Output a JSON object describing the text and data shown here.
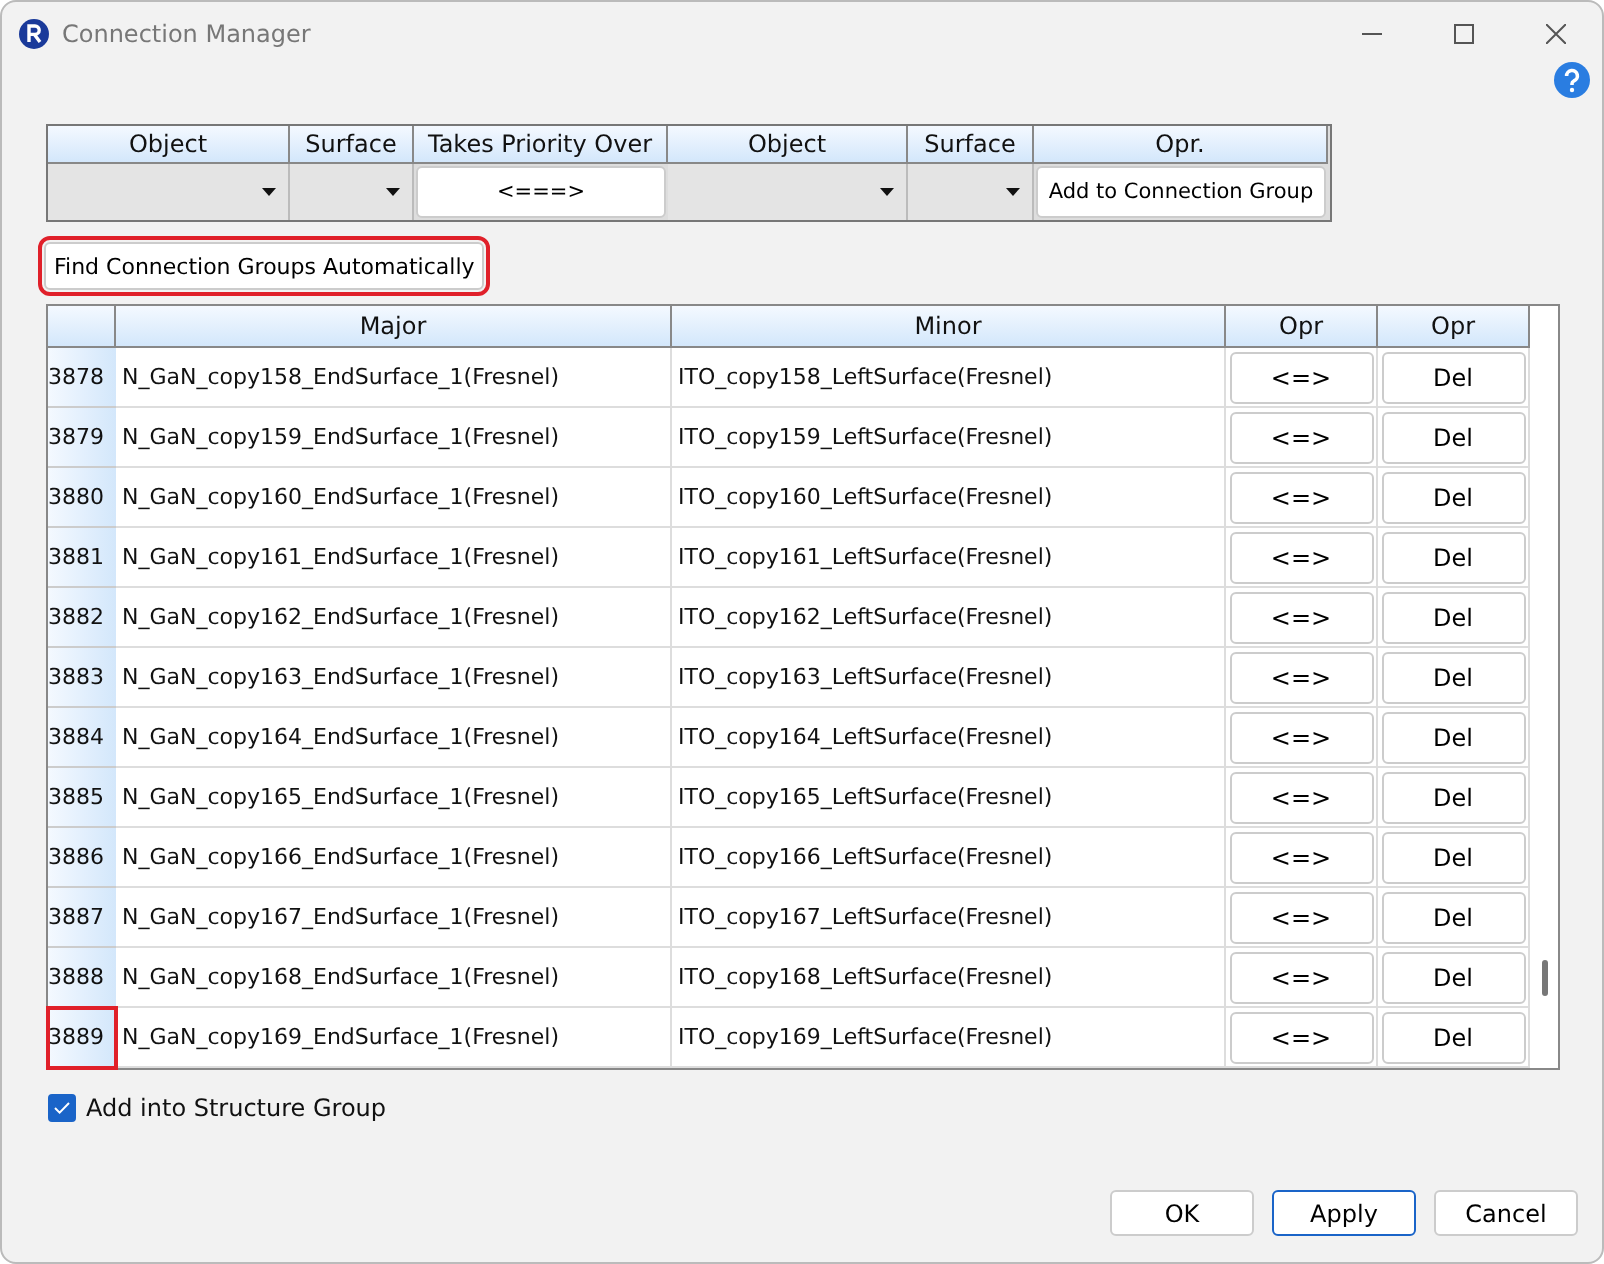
{
  "window": {
    "title": "Connection Manager"
  },
  "connection_form": {
    "columns": [
      "Object",
      "Surface",
      "Takes Priority Over",
      "Object",
      "Surface",
      "Opr."
    ],
    "fields": [
      {
        "kind": "dropdown"
      },
      {
        "kind": "dropdown"
      },
      {
        "kind": "button",
        "label": "<===>"
      },
      {
        "kind": "dropdown"
      },
      {
        "kind": "dropdown"
      },
      {
        "kind": "button",
        "label": "Add to Connection Group"
      }
    ]
  },
  "find_button": {
    "label": "Find Connection Groups Automatically",
    "highlighted": true
  },
  "table": {
    "columns": [
      "Major",
      "Minor",
      "Opr",
      "Opr"
    ],
    "rows": [
      {
        "index": "3878",
        "major": "N_GaN_copy158_EndSurface_1(Fresnel)",
        "minor": "ITO_copy158_LeftSurface(Fresnel)",
        "swap": "<=>",
        "delete": "Del",
        "highlighted": false
      },
      {
        "index": "3879",
        "major": "N_GaN_copy159_EndSurface_1(Fresnel)",
        "minor": "ITO_copy159_LeftSurface(Fresnel)",
        "swap": "<=>",
        "delete": "Del",
        "highlighted": false
      },
      {
        "index": "3880",
        "major": "N_GaN_copy160_EndSurface_1(Fresnel)",
        "minor": "ITO_copy160_LeftSurface(Fresnel)",
        "swap": "<=>",
        "delete": "Del",
        "highlighted": false
      },
      {
        "index": "3881",
        "major": "N_GaN_copy161_EndSurface_1(Fresnel)",
        "minor": "ITO_copy161_LeftSurface(Fresnel)",
        "swap": "<=>",
        "delete": "Del",
        "highlighted": false
      },
      {
        "index": "3882",
        "major": "N_GaN_copy162_EndSurface_1(Fresnel)",
        "minor": "ITO_copy162_LeftSurface(Fresnel)",
        "swap": "<=>",
        "delete": "Del",
        "highlighted": false
      },
      {
        "index": "3883",
        "major": "N_GaN_copy163_EndSurface_1(Fresnel)",
        "minor": "ITO_copy163_LeftSurface(Fresnel)",
        "swap": "<=>",
        "delete": "Del",
        "highlighted": false
      },
      {
        "index": "3884",
        "major": "N_GaN_copy164_EndSurface_1(Fresnel)",
        "minor": "ITO_copy164_LeftSurface(Fresnel)",
        "swap": "<=>",
        "delete": "Del",
        "highlighted": false
      },
      {
        "index": "3885",
        "major": "N_GaN_copy165_EndSurface_1(Fresnel)",
        "minor": "ITO_copy165_LeftSurface(Fresnel)",
        "swap": "<=>",
        "delete": "Del",
        "highlighted": false
      },
      {
        "index": "3886",
        "major": "N_GaN_copy166_EndSurface_1(Fresnel)",
        "minor": "ITO_copy166_LeftSurface(Fresnel)",
        "swap": "<=>",
        "delete": "Del",
        "highlighted": false
      },
      {
        "index": "3887",
        "major": "N_GaN_copy167_EndSurface_1(Fresnel)",
        "minor": "ITO_copy167_LeftSurface(Fresnel)",
        "swap": "<=>",
        "delete": "Del",
        "highlighted": false
      },
      {
        "index": "3888",
        "major": "N_GaN_copy168_EndSurface_1(Fresnel)",
        "minor": "ITO_copy168_LeftSurface(Fresnel)",
        "swap": "<=>",
        "delete": "Del",
        "highlighted": false
      },
      {
        "index": "3889",
        "major": "N_GaN_copy169_EndSurface_1(Fresnel)",
        "minor": "ITO_copy169_LeftSurface(Fresnel)",
        "swap": "<=>",
        "delete": "Del",
        "highlighted": true
      }
    ]
  },
  "structure_group": {
    "label": "Add into Structure Group",
    "checked": true
  },
  "buttons": [
    {
      "label": "OK",
      "default": false
    },
    {
      "label": "Apply",
      "default": true
    },
    {
      "label": "Cancel",
      "default": false
    }
  ]
}
